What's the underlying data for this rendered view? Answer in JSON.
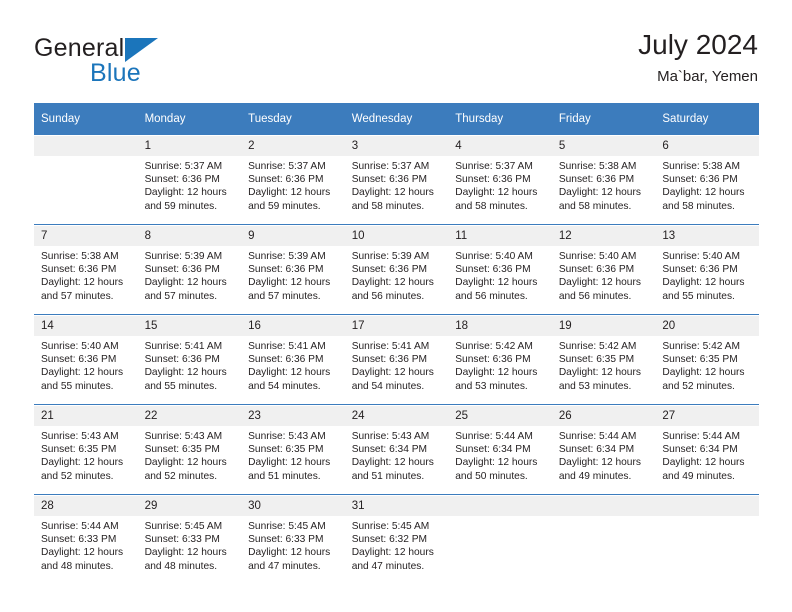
{
  "brand": {
    "name_part1": "General",
    "name_part2": "Blue",
    "logo_icon": "triangle-logo-icon"
  },
  "header": {
    "title": "July 2024",
    "subtitle": "Ma`bar, Yemen"
  },
  "colors": {
    "header_blue": "#3c7cbd",
    "brand_blue": "#1b75bb",
    "daynum_bg": "#f0f0f0",
    "text": "#231f20"
  },
  "weekdays": [
    "Sunday",
    "Monday",
    "Tuesday",
    "Wednesday",
    "Thursday",
    "Friday",
    "Saturday"
  ],
  "weeks": [
    [
      {
        "day": "",
        "sunrise": "",
        "sunset": "",
        "daylight1": "",
        "daylight2": "",
        "empty": true
      },
      {
        "day": "1",
        "sunrise": "Sunrise: 5:37 AM",
        "sunset": "Sunset: 6:36 PM",
        "daylight1": "Daylight: 12 hours",
        "daylight2": "and 59 minutes."
      },
      {
        "day": "2",
        "sunrise": "Sunrise: 5:37 AM",
        "sunset": "Sunset: 6:36 PM",
        "daylight1": "Daylight: 12 hours",
        "daylight2": "and 59 minutes."
      },
      {
        "day": "3",
        "sunrise": "Sunrise: 5:37 AM",
        "sunset": "Sunset: 6:36 PM",
        "daylight1": "Daylight: 12 hours",
        "daylight2": "and 58 minutes."
      },
      {
        "day": "4",
        "sunrise": "Sunrise: 5:37 AM",
        "sunset": "Sunset: 6:36 PM",
        "daylight1": "Daylight: 12 hours",
        "daylight2": "and 58 minutes."
      },
      {
        "day": "5",
        "sunrise": "Sunrise: 5:38 AM",
        "sunset": "Sunset: 6:36 PM",
        "daylight1": "Daylight: 12 hours",
        "daylight2": "and 58 minutes."
      },
      {
        "day": "6",
        "sunrise": "Sunrise: 5:38 AM",
        "sunset": "Sunset: 6:36 PM",
        "daylight1": "Daylight: 12 hours",
        "daylight2": "and 58 minutes."
      }
    ],
    [
      {
        "day": "7",
        "sunrise": "Sunrise: 5:38 AM",
        "sunset": "Sunset: 6:36 PM",
        "daylight1": "Daylight: 12 hours",
        "daylight2": "and 57 minutes."
      },
      {
        "day": "8",
        "sunrise": "Sunrise: 5:39 AM",
        "sunset": "Sunset: 6:36 PM",
        "daylight1": "Daylight: 12 hours",
        "daylight2": "and 57 minutes."
      },
      {
        "day": "9",
        "sunrise": "Sunrise: 5:39 AM",
        "sunset": "Sunset: 6:36 PM",
        "daylight1": "Daylight: 12 hours",
        "daylight2": "and 57 minutes."
      },
      {
        "day": "10",
        "sunrise": "Sunrise: 5:39 AM",
        "sunset": "Sunset: 6:36 PM",
        "daylight1": "Daylight: 12 hours",
        "daylight2": "and 56 minutes."
      },
      {
        "day": "11",
        "sunrise": "Sunrise: 5:40 AM",
        "sunset": "Sunset: 6:36 PM",
        "daylight1": "Daylight: 12 hours",
        "daylight2": "and 56 minutes."
      },
      {
        "day": "12",
        "sunrise": "Sunrise: 5:40 AM",
        "sunset": "Sunset: 6:36 PM",
        "daylight1": "Daylight: 12 hours",
        "daylight2": "and 56 minutes."
      },
      {
        "day": "13",
        "sunrise": "Sunrise: 5:40 AM",
        "sunset": "Sunset: 6:36 PM",
        "daylight1": "Daylight: 12 hours",
        "daylight2": "and 55 minutes."
      }
    ],
    [
      {
        "day": "14",
        "sunrise": "Sunrise: 5:40 AM",
        "sunset": "Sunset: 6:36 PM",
        "daylight1": "Daylight: 12 hours",
        "daylight2": "and 55 minutes."
      },
      {
        "day": "15",
        "sunrise": "Sunrise: 5:41 AM",
        "sunset": "Sunset: 6:36 PM",
        "daylight1": "Daylight: 12 hours",
        "daylight2": "and 55 minutes."
      },
      {
        "day": "16",
        "sunrise": "Sunrise: 5:41 AM",
        "sunset": "Sunset: 6:36 PM",
        "daylight1": "Daylight: 12 hours",
        "daylight2": "and 54 minutes."
      },
      {
        "day": "17",
        "sunrise": "Sunrise: 5:41 AM",
        "sunset": "Sunset: 6:36 PM",
        "daylight1": "Daylight: 12 hours",
        "daylight2": "and 54 minutes."
      },
      {
        "day": "18",
        "sunrise": "Sunrise: 5:42 AM",
        "sunset": "Sunset: 6:36 PM",
        "daylight1": "Daylight: 12 hours",
        "daylight2": "and 53 minutes."
      },
      {
        "day": "19",
        "sunrise": "Sunrise: 5:42 AM",
        "sunset": "Sunset: 6:35 PM",
        "daylight1": "Daylight: 12 hours",
        "daylight2": "and 53 minutes."
      },
      {
        "day": "20",
        "sunrise": "Sunrise: 5:42 AM",
        "sunset": "Sunset: 6:35 PM",
        "daylight1": "Daylight: 12 hours",
        "daylight2": "and 52 minutes."
      }
    ],
    [
      {
        "day": "21",
        "sunrise": "Sunrise: 5:43 AM",
        "sunset": "Sunset: 6:35 PM",
        "daylight1": "Daylight: 12 hours",
        "daylight2": "and 52 minutes."
      },
      {
        "day": "22",
        "sunrise": "Sunrise: 5:43 AM",
        "sunset": "Sunset: 6:35 PM",
        "daylight1": "Daylight: 12 hours",
        "daylight2": "and 52 minutes."
      },
      {
        "day": "23",
        "sunrise": "Sunrise: 5:43 AM",
        "sunset": "Sunset: 6:35 PM",
        "daylight1": "Daylight: 12 hours",
        "daylight2": "and 51 minutes."
      },
      {
        "day": "24",
        "sunrise": "Sunrise: 5:43 AM",
        "sunset": "Sunset: 6:34 PM",
        "daylight1": "Daylight: 12 hours",
        "daylight2": "and 51 minutes."
      },
      {
        "day": "25",
        "sunrise": "Sunrise: 5:44 AM",
        "sunset": "Sunset: 6:34 PM",
        "daylight1": "Daylight: 12 hours",
        "daylight2": "and 50 minutes."
      },
      {
        "day": "26",
        "sunrise": "Sunrise: 5:44 AM",
        "sunset": "Sunset: 6:34 PM",
        "daylight1": "Daylight: 12 hours",
        "daylight2": "and 49 minutes."
      },
      {
        "day": "27",
        "sunrise": "Sunrise: 5:44 AM",
        "sunset": "Sunset: 6:34 PM",
        "daylight1": "Daylight: 12 hours",
        "daylight2": "and 49 minutes."
      }
    ],
    [
      {
        "day": "28",
        "sunrise": "Sunrise: 5:44 AM",
        "sunset": "Sunset: 6:33 PM",
        "daylight1": "Daylight: 12 hours",
        "daylight2": "and 48 minutes."
      },
      {
        "day": "29",
        "sunrise": "Sunrise: 5:45 AM",
        "sunset": "Sunset: 6:33 PM",
        "daylight1": "Daylight: 12 hours",
        "daylight2": "and 48 minutes."
      },
      {
        "day": "30",
        "sunrise": "Sunrise: 5:45 AM",
        "sunset": "Sunset: 6:33 PM",
        "daylight1": "Daylight: 12 hours",
        "daylight2": "and 47 minutes."
      },
      {
        "day": "31",
        "sunrise": "Sunrise: 5:45 AM",
        "sunset": "Sunset: 6:32 PM",
        "daylight1": "Daylight: 12 hours",
        "daylight2": "and 47 minutes."
      },
      {
        "day": "",
        "sunrise": "",
        "sunset": "",
        "daylight1": "",
        "daylight2": "",
        "empty": true
      },
      {
        "day": "",
        "sunrise": "",
        "sunset": "",
        "daylight1": "",
        "daylight2": "",
        "empty": true
      },
      {
        "day": "",
        "sunrise": "",
        "sunset": "",
        "daylight1": "",
        "daylight2": "",
        "empty": true
      }
    ]
  ]
}
